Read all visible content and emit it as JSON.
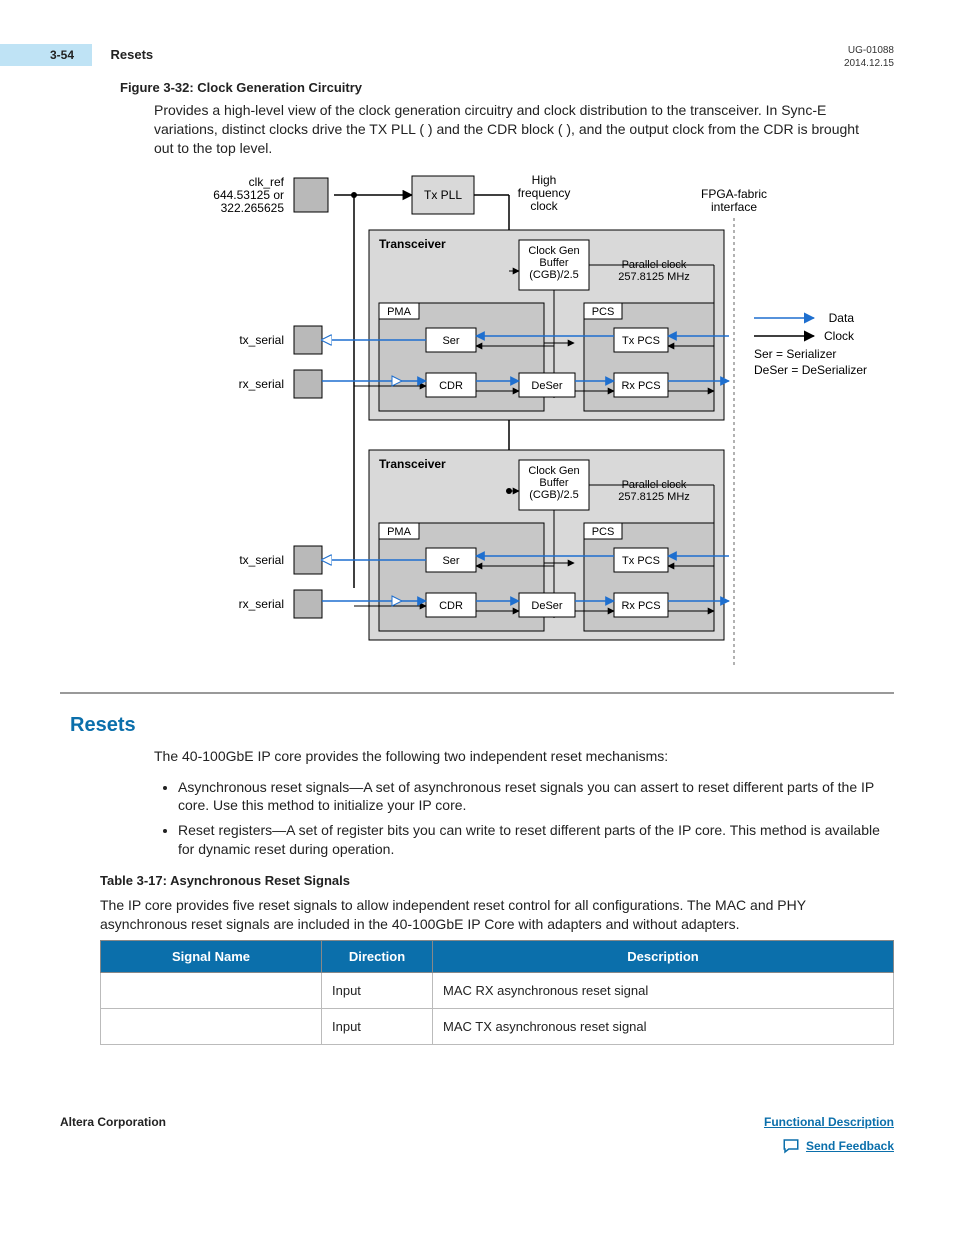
{
  "meta": {
    "doc_id": "UG-01088",
    "date": "2014.12.15",
    "page_tag": "3-54",
    "page_title": "Resets"
  },
  "figure": {
    "caption": "Figure 3-32: Clock Generation Circuitry",
    "para": "Provides a high-level view of the clock generation circuitry and clock distribution to the transceiver. In Sync-E variations, distinct clocks drive the TX PLL (                     ) and the CDR block (                     ), and the output clock from the CDR is brought out to the top level.",
    "labels": {
      "clk_ref": "clk_ref\n644.53125 or\n322.265625",
      "txpll": "Tx PLL",
      "hfc": "High\nfrequency\nclock",
      "fpga": "FPGA-fabric\ninterface",
      "transceiver": "Transceiver",
      "cgb": "Clock Gen\nBuffer\n(CGB)/2.5",
      "parclk": "Parallel clock\n257.8125 MHz",
      "pma": "PMA",
      "pcs": "PCS",
      "ser": "Ser",
      "txpcs": "Tx PCS",
      "cdr": "CDR",
      "deser": "DeSer",
      "rxpcs": "Rx PCS",
      "tx_serial": "tx_serial",
      "rx_serial": "rx_serial",
      "legend_data": "Data",
      "legend_clock": "Clock",
      "legend_ser": "Ser = Serializer",
      "legend_deser": "DeSer = DeSerializer"
    }
  },
  "section": {
    "heading": "Resets",
    "intro": "The 40-100GbE IP core provides the following two independent reset mechanisms:",
    "bullets": [
      "Asynchronous reset signals—A set of asynchronous reset signals you can assert to reset different parts of the IP core. Use this method to initialize your IP core.",
      "Reset registers—A set of register bits you can write to reset different parts of the IP core. This method is available for dynamic reset during operation."
    ]
  },
  "table": {
    "caption": "Table 3-17: Asynchronous Reset Signals",
    "lead": "The IP core provides five reset signals to allow independent reset control for all configurations. The MAC and PHY asynchronous reset signals are included in the 40‑100GbE IP Core with adapters and without adapters.",
    "headers": {
      "c1": "Signal Name",
      "c2": "Direction",
      "c3": "Description"
    },
    "rows": [
      {
        "name": "",
        "dir": "Input",
        "desc": "MAC RX asynchronous reset signal"
      },
      {
        "name": "",
        "dir": "Input",
        "desc": "MAC TX asynchronous reset signal"
      }
    ]
  },
  "footer": {
    "corp": "Altera Corporation",
    "link": "Functional Description",
    "feedback": "Send Feedback"
  }
}
